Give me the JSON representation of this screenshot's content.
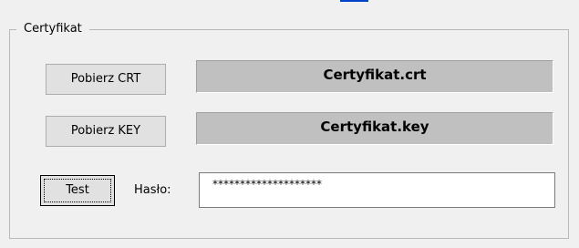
{
  "groupbox": {
    "title": "Certyfikat"
  },
  "buttons": {
    "crt_label": "Pobierz CRT",
    "key_label": "Pobierz KEY",
    "test_label": "Test"
  },
  "files": {
    "crt_name": "Certyfikat.crt",
    "key_name": "Certyfikat.key"
  },
  "password": {
    "label": "Hasło:",
    "value": "********************"
  },
  "colors": {
    "background": "#f0f0f0",
    "file_label_background": "#c0c0c0",
    "button_background": "#e1e1e1",
    "input_background": "#ffffff",
    "link": "#0044cc"
  }
}
